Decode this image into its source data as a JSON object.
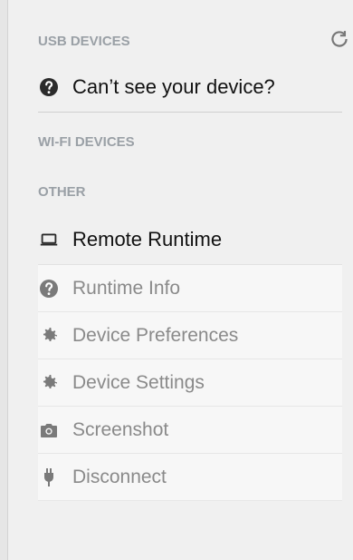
{
  "sections": {
    "usb": {
      "title": "USB DEVICES",
      "cant_see": "Can’t see your device?"
    },
    "wifi": {
      "title": "WI-FI DEVICES"
    },
    "other": {
      "title": "OTHER",
      "remote_runtime": "Remote Runtime"
    }
  },
  "menu": {
    "items": [
      {
        "label": "Runtime Info"
      },
      {
        "label": "Device Preferences"
      },
      {
        "label": "Device Settings"
      },
      {
        "label": "Screenshot"
      },
      {
        "label": "Disconnect"
      }
    ]
  }
}
